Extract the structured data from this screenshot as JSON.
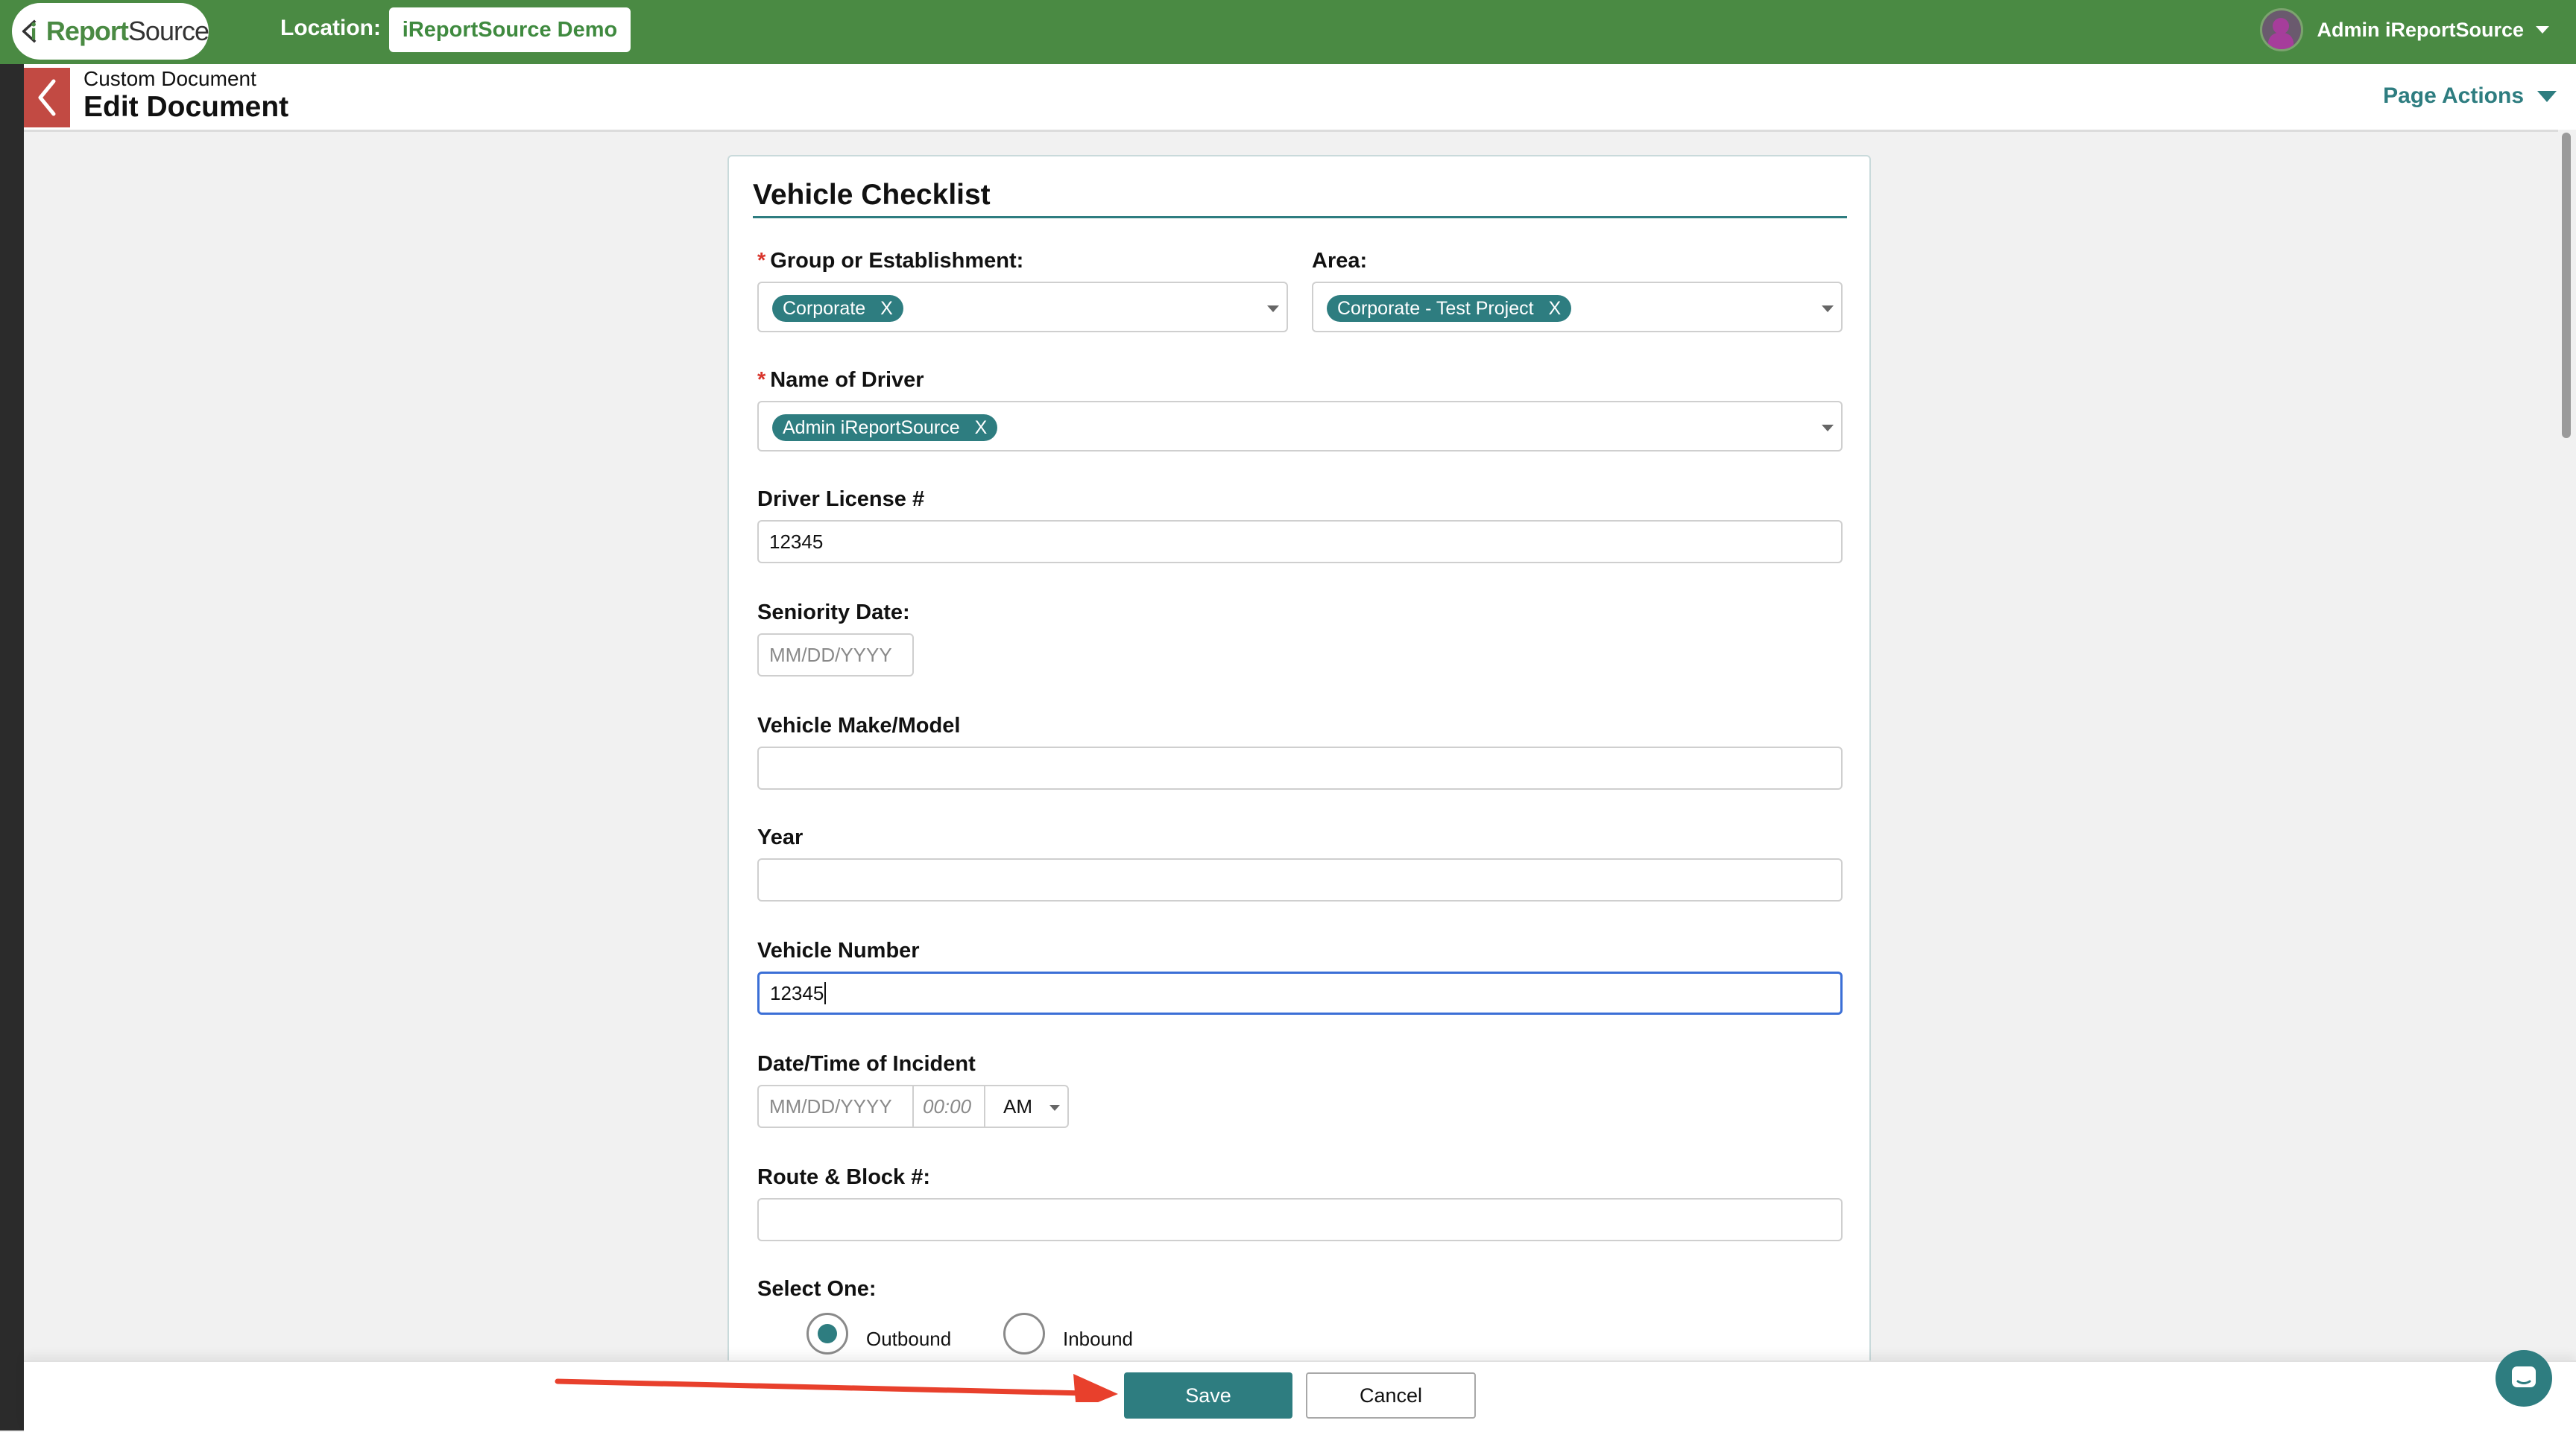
{
  "topbar": {
    "logo_prefix": "i",
    "logo_report": "Report",
    "logo_source": "Source",
    "location_label": "Location:",
    "location_value": "iReportSource Demo",
    "user_name": "Admin iReportSource"
  },
  "header": {
    "breadcrumb": "Custom Document",
    "title": "Edit Document",
    "page_actions": "Page Actions"
  },
  "form": {
    "title": "Vehicle Checklist",
    "group": {
      "label": "Group or Establishment:",
      "chip": "Corporate",
      "remove": "X"
    },
    "area": {
      "label": "Area:",
      "chip": "Corporate - Test Project",
      "remove": "X"
    },
    "driver": {
      "label": "Name of Driver",
      "chip": "Admin iReportSource",
      "remove": "X"
    },
    "license": {
      "label": "Driver License #",
      "value": "12345"
    },
    "seniority": {
      "label": "Seniority Date:",
      "placeholder": "MM/DD/YYYY"
    },
    "make_model": {
      "label": "Vehicle Make/Model",
      "value": ""
    },
    "year": {
      "label": "Year",
      "value": ""
    },
    "vehicle_number": {
      "label": "Vehicle Number",
      "value": "12345"
    },
    "incident": {
      "label": "Date/Time of Incident",
      "date_placeholder": "MM/DD/YYYY",
      "time_placeholder": "00:00",
      "ampm": "AM"
    },
    "route": {
      "label": "Route & Block #:",
      "value": ""
    },
    "select_one": {
      "label": "Select One:",
      "options": [
        "Outbound",
        "Inbound"
      ],
      "selected": "Outbound"
    },
    "required_mark": "*"
  },
  "footer": {
    "save_label": "Save",
    "cancel_label": "Cancel"
  },
  "colors": {
    "topbar": "#4a8a43",
    "accent": "#2e7d80",
    "back_button": "#c24a43",
    "annotation_arrow": "#e8402c"
  },
  "icons": [
    "chevron-left-icon",
    "chevron-down-icon",
    "avatar",
    "chat-icon",
    "red-arrow-annotation"
  ]
}
